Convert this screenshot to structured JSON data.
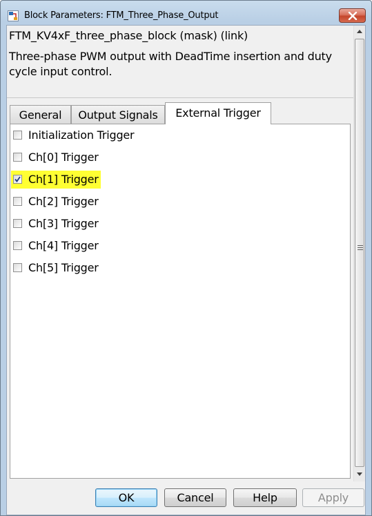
{
  "window": {
    "title": "Block Parameters: FTM_Three_Phase_Output"
  },
  "mask": {
    "title": "FTM_KV4xF_three_phase_block (mask) (link)",
    "description": "Three-phase PWM output with DeadTime insertion and duty cycle input control."
  },
  "tabs": [
    {
      "label": "General",
      "active": false
    },
    {
      "label": "Output Signals",
      "active": false
    },
    {
      "label": "External Trigger",
      "active": true
    }
  ],
  "triggers": [
    {
      "label": "Initialization Trigger",
      "checked": false,
      "highlighted": false
    },
    {
      "label": "Ch[0] Trigger",
      "checked": false,
      "highlighted": false
    },
    {
      "label": "Ch[1] Trigger",
      "checked": true,
      "highlighted": true
    },
    {
      "label": "Ch[2] Trigger",
      "checked": false,
      "highlighted": false
    },
    {
      "label": "Ch[3] Trigger",
      "checked": false,
      "highlighted": false
    },
    {
      "label": "Ch[4] Trigger",
      "checked": false,
      "highlighted": false
    },
    {
      "label": "Ch[5] Trigger",
      "checked": false,
      "highlighted": false
    }
  ],
  "buttons": {
    "ok": "OK",
    "cancel": "Cancel",
    "help": "Help",
    "apply": "Apply",
    "apply_enabled": false
  },
  "colors": {
    "highlight": "#ffff33",
    "close_button": "#c4452c"
  },
  "icons": {
    "app": "simulink-block-icon",
    "close": "close-icon"
  }
}
